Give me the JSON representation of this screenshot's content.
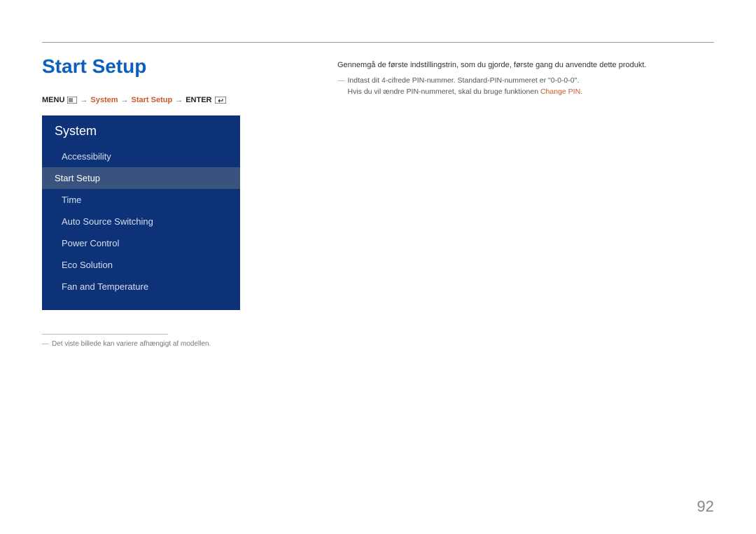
{
  "page_title": "Start Setup",
  "breadcrumb": {
    "menu_label": "MENU",
    "arrow": "→",
    "system": "System",
    "start_setup": "Start Setup",
    "enter_label": "ENTER"
  },
  "menu_panel": {
    "title": "System",
    "items": [
      {
        "label": "Accessibility",
        "selected": false
      },
      {
        "label": "Start Setup",
        "selected": true
      },
      {
        "label": "Time",
        "selected": false
      },
      {
        "label": "Auto Source Switching",
        "selected": false
      },
      {
        "label": "Power Control",
        "selected": false
      },
      {
        "label": "Eco Solution",
        "selected": false
      },
      {
        "label": "Fan and Temperature",
        "selected": false
      }
    ]
  },
  "left_footnote": {
    "dash": "―",
    "text": "Det viste billede kan variere afhængigt af modellen."
  },
  "right": {
    "intro": "Gennemgå de første indstillingstrin, som du gjorde, første gang du anvendte dette produkt.",
    "note_dash": "―",
    "note_line1": "Indtast dit 4-cifrede PIN-nummer. Standard-PIN-nummeret er \"0-0-0-0\".",
    "note_line2_prefix": "Hvis du vil ændre PIN-nummeret, skal du bruge funktionen ",
    "note_line2_accent": "Change PIN",
    "note_line2_suffix": "."
  },
  "page_number": "92"
}
